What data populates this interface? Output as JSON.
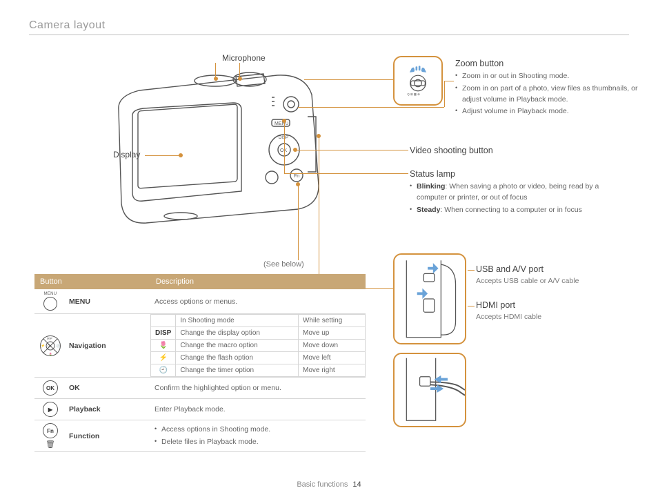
{
  "page": {
    "title": "Camera layout",
    "see_below": "(See below)",
    "footer_section": "Basic functions",
    "footer_page": "14"
  },
  "labels": {
    "microphone": "Microphone",
    "display": "Display"
  },
  "callouts": {
    "zoom": {
      "title": "Zoom button",
      "items": [
        "Zoom in or out in Shooting mode.",
        "Zoom in on part of a photo, view files as thumbnails, or adjust volume in Playback mode.",
        "Adjust volume in Playback mode."
      ]
    },
    "video": {
      "title": "Video shooting button"
    },
    "status": {
      "title": "Status lamp",
      "items": [
        {
          "bold": "Blinking",
          "text": ": When saving a photo or video, being read by a computer or printer, or out of focus"
        },
        {
          "bold": "Steady",
          "text": ": When connecting to a computer or in focus"
        }
      ]
    },
    "usb": {
      "title": "USB and A/V port",
      "sub": "Accepts USB cable or A/V cable"
    },
    "hdmi": {
      "title": "HDMI port",
      "sub": "Accepts HDMI cable"
    }
  },
  "table": {
    "head1": "Button",
    "head2": "Description",
    "rows": {
      "menu": {
        "name": "MENU",
        "desc": "Access options or menus."
      },
      "nav": {
        "name": "Navigation",
        "sub_head1": "In Shooting mode",
        "sub_head2": "While setting",
        "subrows": [
          {
            "icon": "DISP",
            "a": "Change the display option",
            "b": "Move up"
          },
          {
            "icon": "🌷",
            "a": "Change the macro option",
            "b": "Move down"
          },
          {
            "icon": "⚡",
            "a": "Change the flash option",
            "b": "Move left"
          },
          {
            "icon": "🕘",
            "a": "Change the timer option",
            "b": "Move right"
          }
        ]
      },
      "ok": {
        "name": "OK",
        "desc": "Confirm the highlighted option or menu."
      },
      "playback": {
        "name": "Playback",
        "desc": "Enter Playback mode."
      },
      "fn": {
        "name": "Function",
        "items": [
          "Access options in Shooting mode.",
          "Delete files in Playback mode."
        ]
      }
    }
  }
}
